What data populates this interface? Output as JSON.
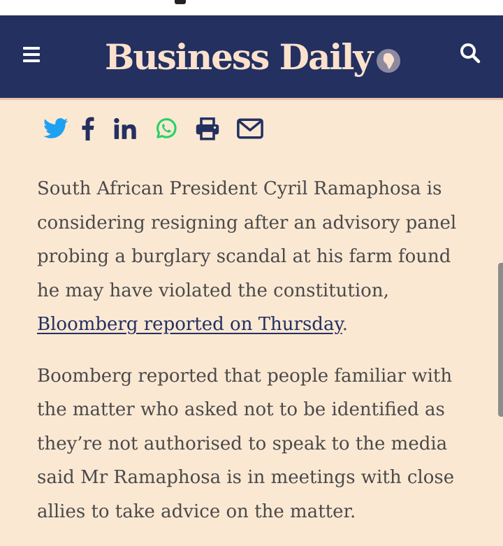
{
  "header": {
    "brand": "Business Daily",
    "menu_icon": "hamburger-menu-icon",
    "search_icon": "search-icon",
    "bg_color": "#233060",
    "brand_color": "#fbe1cc"
  },
  "share_icons": [
    "twitter-icon",
    "facebook-icon",
    "linkedin-icon",
    "whatsapp-icon",
    "print-icon",
    "email-icon"
  ],
  "share_colors": {
    "twitter": "#1da1f2",
    "facebook": "#233060",
    "linkedin": "#233060",
    "whatsapp": "#25d366",
    "print": "#233060",
    "email": "#233060"
  },
  "article": {
    "p1_text": "South African President Cyril Ramaphosa is considering resigning after an advisory panel probing a burglary scandal at his farm found he may have violated the constitution, ",
    "p1_link": "Bloomberg reported on Thursday",
    "p1_end": ".",
    "p2_text": "Boomberg reported that people familiar with the matter who asked not to be identified as they’re not authorised to speak to the media said Mr Ramaphosa is in meetings with close allies to take advice on the matter."
  },
  "page_bg": "#fbe8d3"
}
